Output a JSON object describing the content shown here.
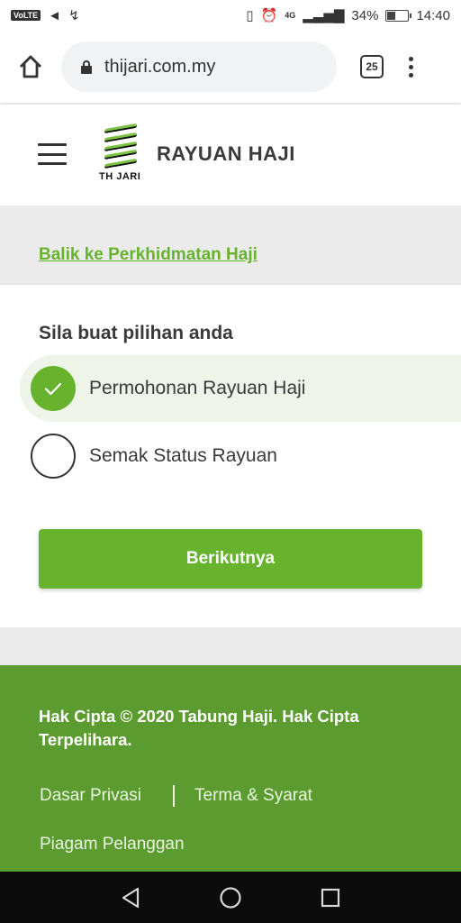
{
  "status_bar": {
    "volte": "VoLTE",
    "network": "4G",
    "battery": "34%",
    "battery_level": 0.34,
    "time": "14:40"
  },
  "browser": {
    "url": "thijari.com.my",
    "tab_count": "25"
  },
  "header": {
    "logo_text": "TH JARI",
    "title": "RAYUAN HAJI"
  },
  "back_link": "Balik ke Perkhidmatan Haji",
  "form": {
    "prompt": "Sila buat pilihan anda",
    "options": [
      {
        "label": "Permohonan Rayuan Haji",
        "selected": true
      },
      {
        "label": "Semak Status Rayuan",
        "selected": false
      }
    ],
    "next_label": "Berikutnya"
  },
  "footer": {
    "copyright": "Hak Cipta © 2020 Tabung Haji. Hak Cipta Terpelihara.",
    "links": [
      "Dasar Privasi",
      "Terma & Syarat",
      "Piagam Pelanggan"
    ]
  },
  "colors": {
    "accent": "#67b32e",
    "footer_bg": "#5b9b2f",
    "band_bg": "#ebebeb"
  },
  "icons": {
    "home": "home-icon",
    "lock": "lock-icon",
    "menu": "more-vert-icon",
    "hamburger": "hamburger-icon",
    "check": "check-icon",
    "nav_back": "triangle-back-icon",
    "nav_home": "circle-home-icon",
    "nav_recents": "square-recents-icon"
  }
}
